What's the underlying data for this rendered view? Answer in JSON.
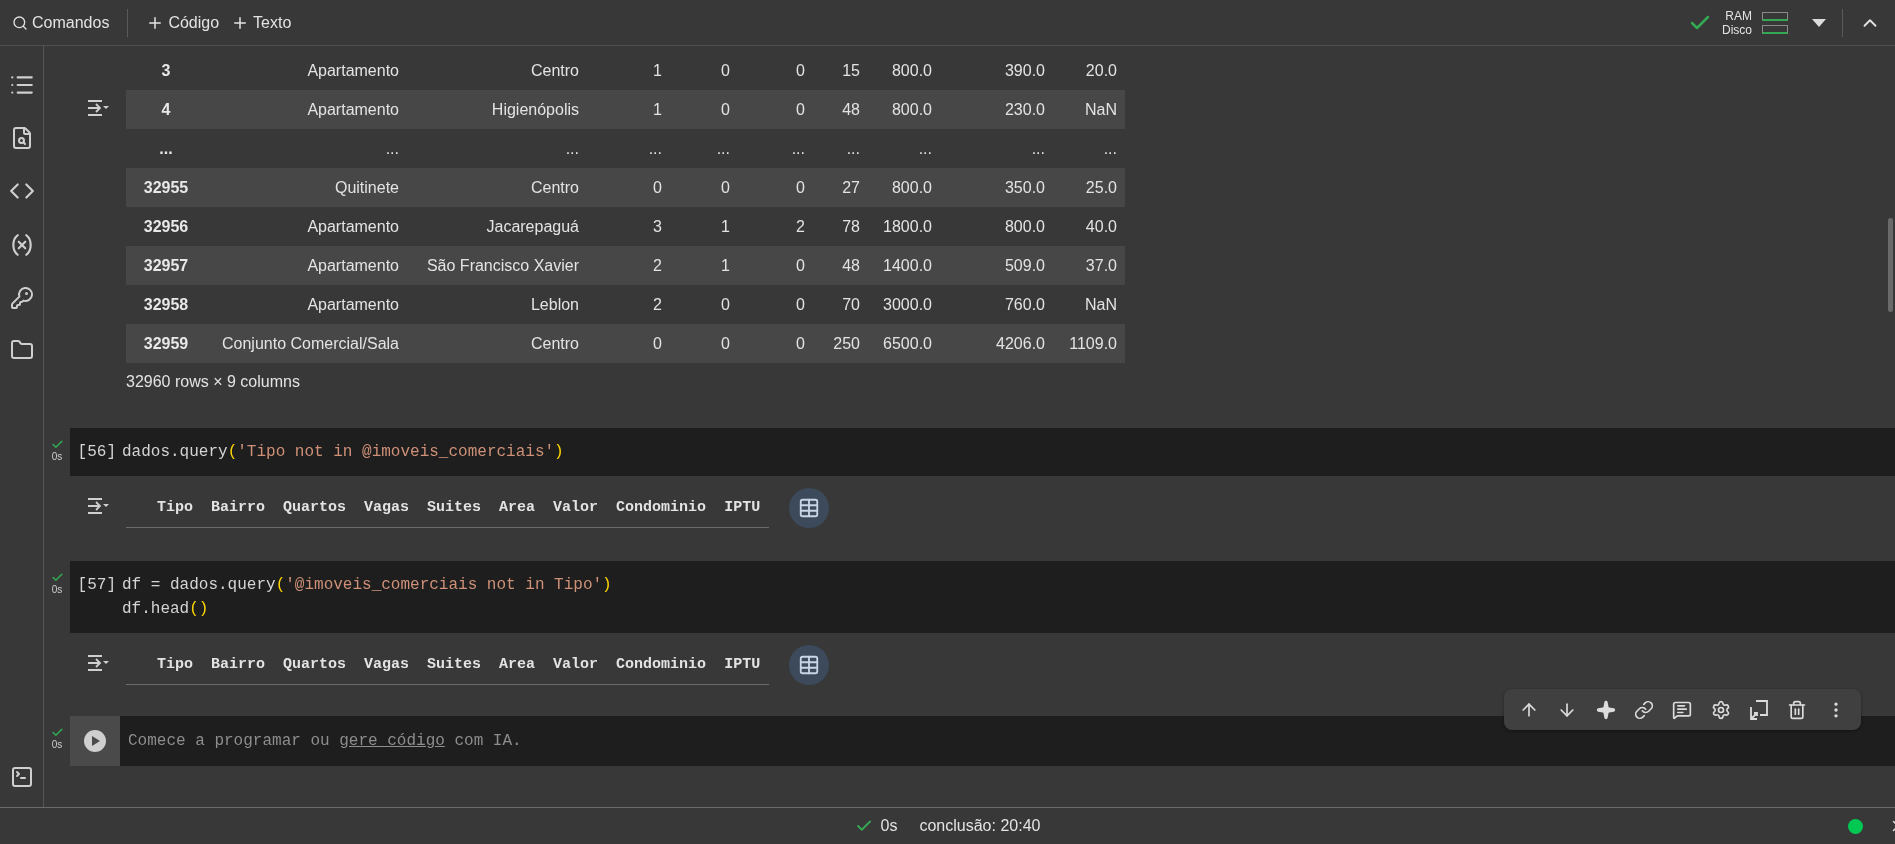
{
  "toolbar": {
    "search_label": "Comandos",
    "add_code": "Código",
    "add_text": "Texto"
  },
  "resources": {
    "connected": true,
    "ram": "RAM",
    "disk": "Disco"
  },
  "table_output": {
    "rows": [
      {
        "index": "3",
        "values": [
          "Apartamento",
          "Centro",
          "1",
          "0",
          "0",
          "15",
          "800.0",
          "390.0",
          "20.0"
        ]
      },
      {
        "index": "4",
        "values": [
          "Apartamento",
          "Higienópolis",
          "1",
          "0",
          "0",
          "48",
          "800.0",
          "230.0",
          "NaN"
        ]
      },
      {
        "index": "...",
        "values": [
          "...",
          "...",
          "...",
          "...",
          "...",
          "...",
          "...",
          "...",
          "..."
        ]
      },
      {
        "index": "32955",
        "values": [
          "Quitinete",
          "Centro",
          "0",
          "0",
          "0",
          "27",
          "800.0",
          "350.0",
          "25.0"
        ]
      },
      {
        "index": "32956",
        "values": [
          "Apartamento",
          "Jacarepaguá",
          "3",
          "1",
          "2",
          "78",
          "1800.0",
          "800.0",
          "40.0"
        ]
      },
      {
        "index": "32957",
        "values": [
          "Apartamento",
          "São Francisco Xavier",
          "2",
          "1",
          "0",
          "48",
          "1400.0",
          "509.0",
          "37.0"
        ]
      },
      {
        "index": "32958",
        "values": [
          "Apartamento",
          "Leblon",
          "2",
          "0",
          "0",
          "70",
          "3000.0",
          "760.0",
          "NaN"
        ]
      },
      {
        "index": "32959",
        "values": [
          "Conjunto Comercial/Sala",
          "Centro",
          "0",
          "0",
          "0",
          "250",
          "6500.0",
          "4206.0",
          "1109.0"
        ]
      }
    ],
    "caption": "32960 rows × 9 columns"
  },
  "cells": [
    {
      "exec_count": "[56]",
      "time": "0s",
      "executed": true,
      "lines": [
        [
          {
            "kind": "plain",
            "text": "dados.query"
          },
          {
            "kind": "paren",
            "text": "("
          },
          {
            "kind": "string",
            "text": "'Tipo not in @imoveis_comerciais'"
          },
          {
            "kind": "paren",
            "text": ")"
          }
        ]
      ],
      "output_columns": [
        "Tipo",
        "Bairro",
        "Quartos",
        "Vagas",
        "Suites",
        "Area",
        "Valor",
        "Condominio",
        "IPTU"
      ]
    },
    {
      "exec_count": "[57]",
      "time": "0s",
      "executed": true,
      "lines": [
        [
          {
            "kind": "plain",
            "text": "df = dados.query"
          },
          {
            "kind": "paren",
            "text": "("
          },
          {
            "kind": "string",
            "text": "'@imoveis_comerciais not in Tipo'"
          },
          {
            "kind": "paren",
            "text": ")"
          }
        ],
        [
          {
            "kind": "plain",
            "text": "df.head"
          },
          {
            "kind": "paren",
            "text": "()"
          }
        ]
      ],
      "output_columns": [
        "Tipo",
        "Bairro",
        "Quartos",
        "Vagas",
        "Suites",
        "Area",
        "Valor",
        "Condominio",
        "IPTU"
      ]
    }
  ],
  "empty_cell": {
    "time": "0s",
    "executed": true,
    "placeholder_before": "Comece a programar ou ",
    "placeholder_link": "gere código",
    "placeholder_after": " com IA."
  },
  "status_bar": {
    "executed": true,
    "time": "0s",
    "completion": "conclusão: 20:40",
    "connected": true
  }
}
